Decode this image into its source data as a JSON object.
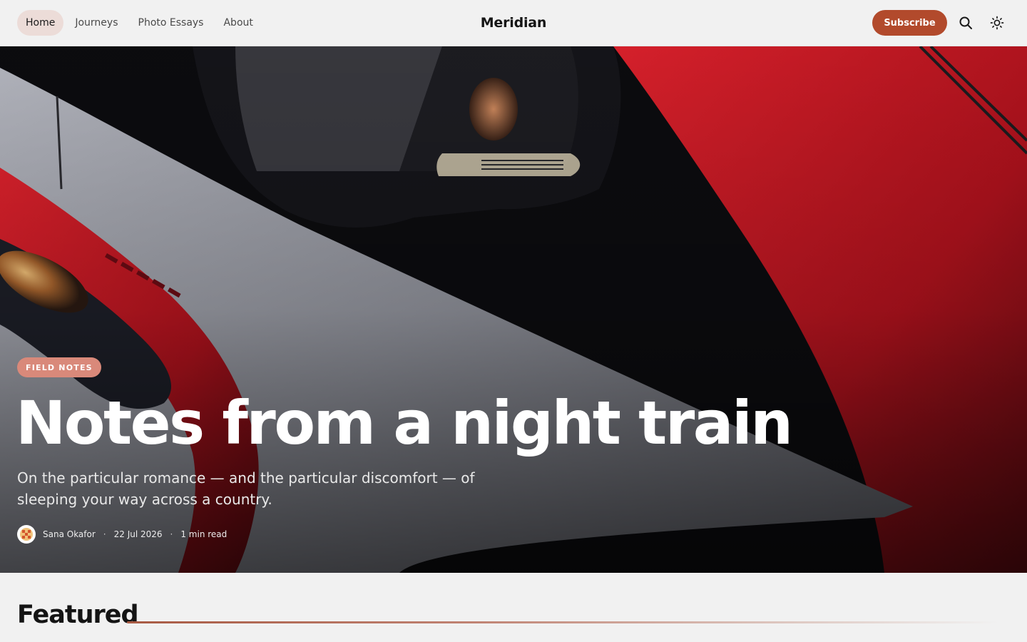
{
  "header": {
    "nav": [
      {
        "label": "Home",
        "active": true
      },
      {
        "label": "Journeys",
        "active": false
      },
      {
        "label": "Photo Essays",
        "active": false
      },
      {
        "label": "About",
        "active": false
      }
    ],
    "brand": "Meridian",
    "subscribe_label": "Subscribe",
    "search_icon": "search-icon",
    "theme_icon": "sun-icon"
  },
  "hero": {
    "tag": "FIELD NOTES",
    "title": "Notes from a night train",
    "subtitle": "On the particular romance — and the particular discomfort — of sleeping your way across a country.",
    "author": "Sana Okafor",
    "date": "22 Jul 2026",
    "read_time": "1 min read",
    "separator": "·"
  },
  "section": {
    "title": "Featured"
  },
  "colors": {
    "accent": "#b24a2c",
    "tag": "#d9897a",
    "active_nav": "#ecdcd8",
    "background": "#f1f1f1"
  }
}
